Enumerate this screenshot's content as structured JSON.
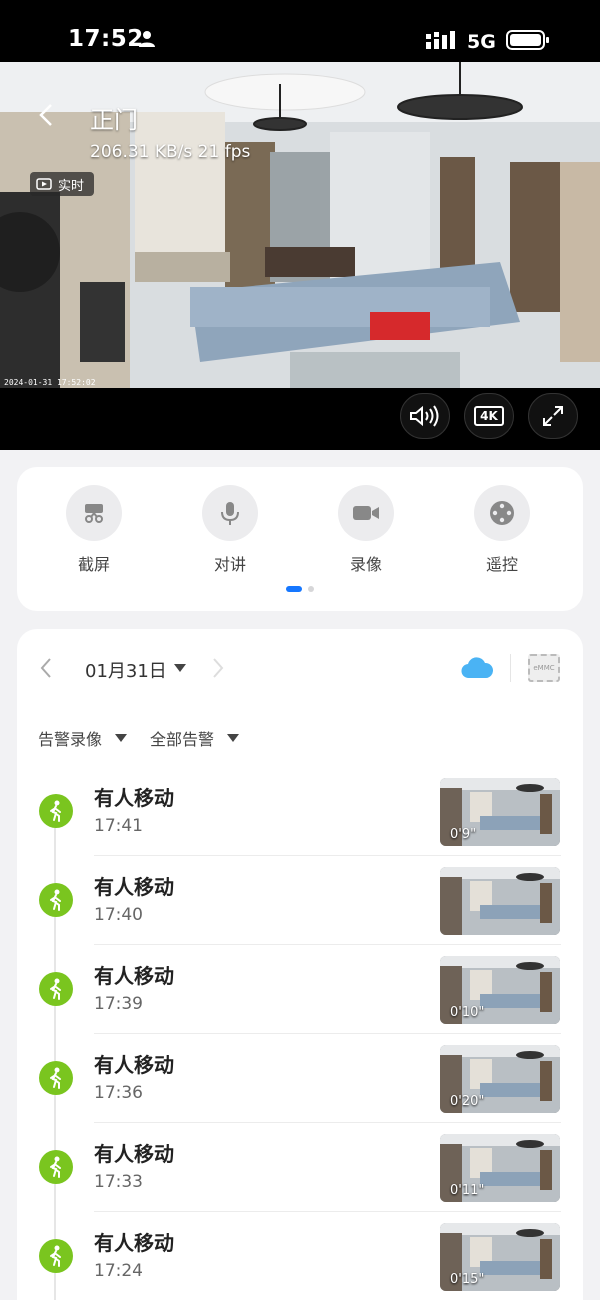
{
  "status_bar": {
    "time": "17:52",
    "network": "5G"
  },
  "camera": {
    "title": "正门",
    "stream_stats": "206.31 KB/s  21 fps",
    "live_label": "实时",
    "timestamp": "2024-01-31  17:52:02"
  },
  "video_controls": {
    "quality_label": "4K"
  },
  "tools": [
    {
      "label": "截屏",
      "icon": "screenshot-icon"
    },
    {
      "label": "对讲",
      "icon": "microphone-icon"
    },
    {
      "label": "录像",
      "icon": "video-camera-icon"
    },
    {
      "label": "遥控",
      "icon": "remote-control-icon"
    }
  ],
  "recordings": {
    "date": "01月31日",
    "storage_label": "eMMC",
    "filters": {
      "type": "告警录像",
      "scope": "全部告警"
    },
    "events": [
      {
        "title": "有人移动",
        "time": "17:41",
        "duration": "0'9\""
      },
      {
        "title": "有人移动",
        "time": "17:40",
        "duration": ""
      },
      {
        "title": "有人移动",
        "time": "17:39",
        "duration": "0'10\""
      },
      {
        "title": "有人移动",
        "time": "17:36",
        "duration": "0'20\""
      },
      {
        "title": "有人移动",
        "time": "17:33",
        "duration": "0'11\""
      },
      {
        "title": "有人移动",
        "time": "17:24",
        "duration": "0'15\""
      }
    ]
  },
  "colors": {
    "accent": "#1677ff",
    "motion_green": "#7ac51f",
    "cloud_blue": "#4ab3f4"
  }
}
